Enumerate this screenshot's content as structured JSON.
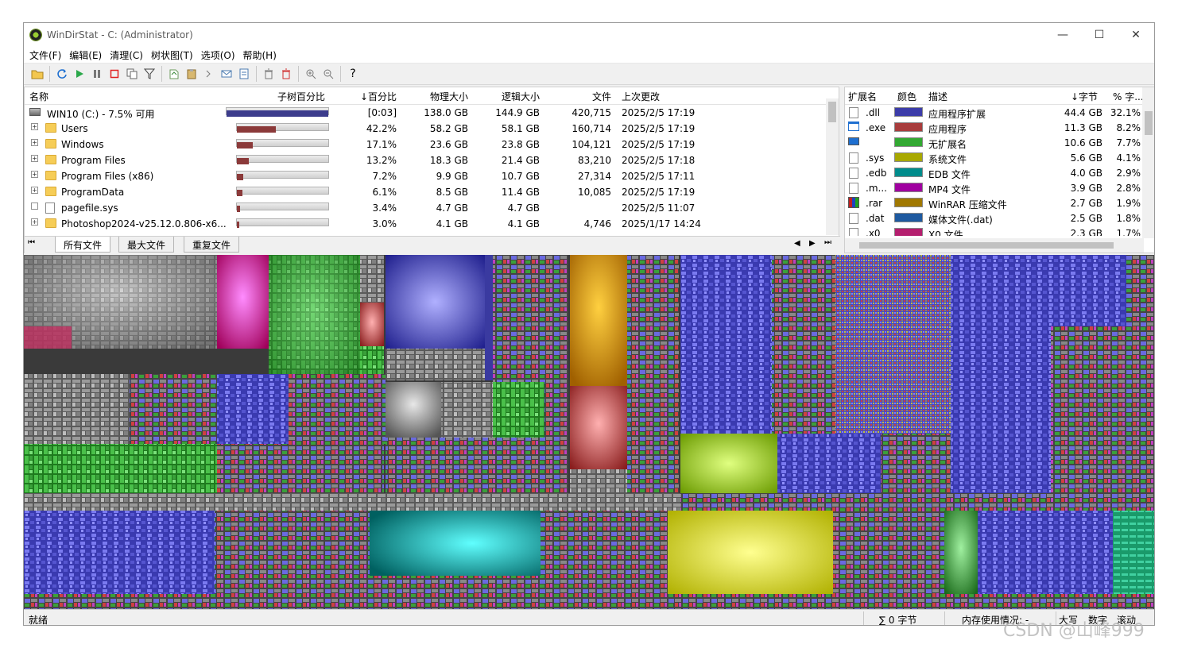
{
  "window": {
    "title": "WinDirStat - C:  (Administrator)"
  },
  "menu": [
    "文件(F)",
    "编辑(E)",
    "清理(C)",
    "树状图(T)",
    "选项(O)",
    "帮助(H)"
  ],
  "tree": {
    "headers": {
      "name": "名称",
      "subtree": "子树百分比",
      "percent": "↓百分比",
      "physical": "物理大小",
      "logical": "逻辑大小",
      "files": "文件",
      "modified": "上次更改"
    },
    "rows": [
      {
        "name": "WIN10 (C:) - 7.5% 可用",
        "percent": "[0:03]",
        "physical": "138.0 GB",
        "logical": "144.9 GB",
        "files": "420,715",
        "modified": "2025/2/5   17:19",
        "bar": 1.0,
        "color": "#3c3c8c"
      },
      {
        "name": "Users",
        "percent": "42.2%",
        "physical": "58.2 GB",
        "logical": "58.1 GB",
        "files": "160,714",
        "modified": "2025/2/5   17:19",
        "bar": 0.422,
        "color": "#8b3a3a"
      },
      {
        "name": "Windows",
        "percent": "17.1%",
        "physical": "23.6 GB",
        "logical": "23.8 GB",
        "files": "104,121",
        "modified": "2025/2/5   17:19",
        "bar": 0.171,
        "color": "#8b3a3a"
      },
      {
        "name": "Program Files",
        "percent": "13.2%",
        "physical": "18.3 GB",
        "logical": "21.4 GB",
        "files": "83,210",
        "modified": "2025/2/5   17:18",
        "bar": 0.132,
        "color": "#8b3a3a"
      },
      {
        "name": "Program Files (x86)",
        "percent": "7.2%",
        "physical": "9.9 GB",
        "logical": "10.7 GB",
        "files": "27,314",
        "modified": "2025/2/5   17:11",
        "bar": 0.072,
        "color": "#8b3a3a"
      },
      {
        "name": "ProgramData",
        "percent": "6.1%",
        "physical": "8.5 GB",
        "logical": "11.4 GB",
        "files": "10,085",
        "modified": "2025/2/5   17:19",
        "bar": 0.061,
        "color": "#8b3a3a"
      },
      {
        "name": "pagefile.sys",
        "percent": "3.4%",
        "physical": "4.7 GB",
        "logical": "4.7 GB",
        "files": "",
        "modified": "2025/2/5   11:07",
        "bar": 0.034,
        "color": "#8b3a3a"
      },
      {
        "name": "Photoshop2024-v25.12.0.806-x6...",
        "percent": "3.0%",
        "physical": "4.1 GB",
        "logical": "4.1 GB",
        "files": "4,746",
        "modified": "2025/1/17   14:24",
        "bar": 0.03,
        "color": "#8b3a3a"
      }
    ]
  },
  "tabs": [
    "所有文件",
    "最大文件",
    "重复文件"
  ],
  "ext": {
    "headers": {
      "ext": "扩展名",
      "color": "颜色",
      "desc": "描述",
      "bytes": "↓字节",
      "pct": "% 字..."
    },
    "rows": [
      {
        "ext": ".dll",
        "color": "#3c3ca8",
        "desc": "应用程序扩展",
        "bytes": "44.4 GB",
        "pct": "32.1%"
      },
      {
        "ext": ".exe",
        "color": "#a83c3c",
        "desc": "应用程序",
        "bytes": "11.3 GB",
        "pct": "8.2%"
      },
      {
        "ext": "",
        "color": "#32a832",
        "desc": "无扩展名",
        "bytes": "10.6 GB",
        "pct": "7.7%"
      },
      {
        "ext": ".sys",
        "color": "#a8a800",
        "desc": "系统文件",
        "bytes": "5.6 GB",
        "pct": "4.1%"
      },
      {
        "ext": ".edb",
        "color": "#008c8c",
        "desc": "EDB 文件",
        "bytes": "4.0 GB",
        "pct": "2.9%"
      },
      {
        "ext": ".m...",
        "color": "#a000a0",
        "desc": "MP4 文件",
        "bytes": "3.9 GB",
        "pct": "2.8%"
      },
      {
        "ext": ".rar",
        "color": "#a07800",
        "desc": "WinRAR 压缩文件",
        "bytes": "2.7 GB",
        "pct": "1.9%"
      },
      {
        "ext": ".dat",
        "color": "#1e5aa0",
        "desc": "媒体文件(.dat)",
        "bytes": "2.5 GB",
        "pct": "1.8%"
      },
      {
        "ext": ".x0",
        "color": "#b41e6e",
        "desc": "X0 文件",
        "bytes": "2.3 GB",
        "pct": "1.7%"
      }
    ]
  },
  "status": {
    "ready": "就绪",
    "sum": "∑ 0 字节",
    "memory": "内存使用情况: -",
    "caps": "大写",
    "num": "数字",
    "scroll": "滚动"
  },
  "watermark": "CSDN @山峰999",
  "icons": [
    "open-icon",
    "refresh-icon",
    "play-icon",
    "pause-icon",
    "stop-icon",
    "copy-path-icon",
    "filter-icon",
    "explorer-icon",
    "clipboard-icon",
    "cmd-icon",
    "email-icon",
    "properties-icon",
    "recycle-icon",
    "delete-icon",
    "zoom-in-icon",
    "zoom-out-icon",
    "help-icon"
  ]
}
